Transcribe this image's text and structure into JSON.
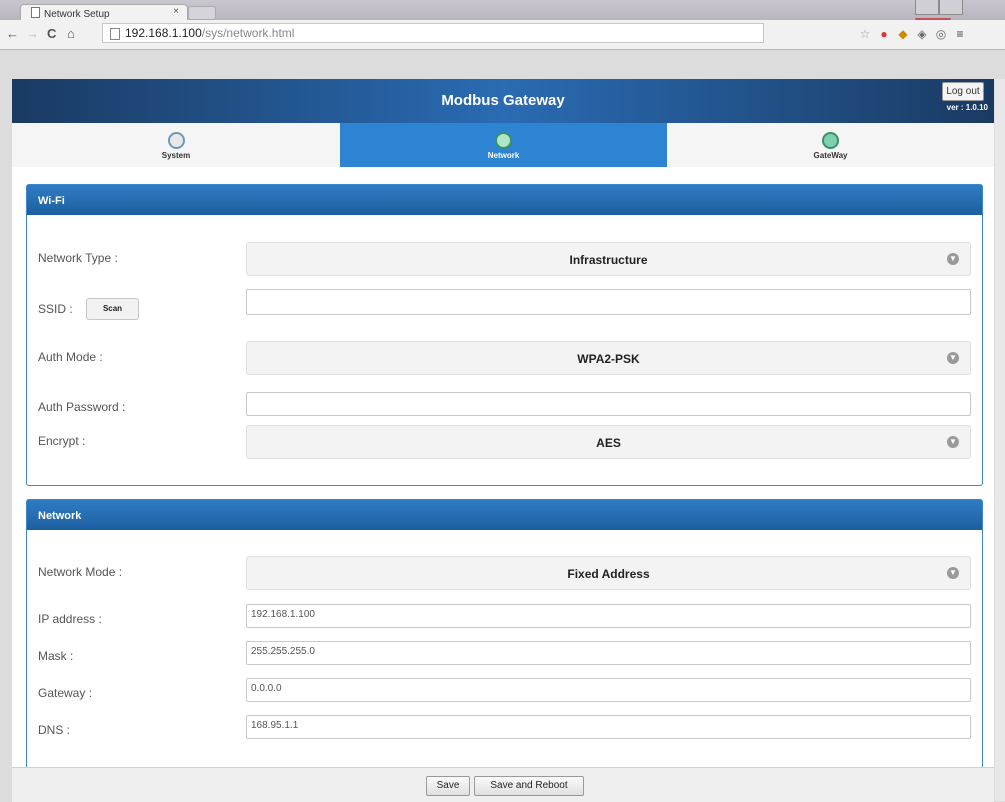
{
  "browser": {
    "tab_title": "Network Setup",
    "tab_close": "×",
    "url_host": "192.168.1.100",
    "url_path": "/sys/network.html"
  },
  "header": {
    "title": "Modbus Gateway",
    "logout_label": "Log out",
    "version": "ver : 1.0.10"
  },
  "nav": {
    "items": [
      {
        "label": "System",
        "icon": "system-icon"
      },
      {
        "label": "Network",
        "icon": "network-icon"
      },
      {
        "label": "GateWay",
        "icon": "gateway-icon"
      }
    ],
    "active": "Network"
  },
  "wifi": {
    "title": "Wi-Fi",
    "network_type_label": "Network Type :",
    "network_type_value": "Infrastructure",
    "ssid_label": "SSID :",
    "scan_label": "Scan",
    "ssid_value": "",
    "auth_mode_label": "Auth Mode :",
    "auth_mode_value": "WPA2-PSK",
    "auth_password_label": "Auth Password :",
    "auth_password_value": "",
    "encrypt_label": "Encrypt :",
    "encrypt_value": "AES"
  },
  "network": {
    "title": "Network",
    "mode_label": "Network Mode :",
    "mode_value": "Fixed Address",
    "ip_label": "IP address :",
    "ip_value": "192.168.1.100",
    "mask_label": "Mask :",
    "mask_value": "255.255.255.0",
    "gateway_label": "Gateway :",
    "gateway_value": "0.0.0.0",
    "dns_label": "DNS :",
    "dns_value": "168.95.1.1"
  },
  "footer": {
    "save_label": "Save",
    "save_reboot_label": "Save and Reboot"
  },
  "colors": {
    "header_blue": "#1a3a62",
    "active_tab": "#2c84d2",
    "panel_head": "#2f7cc3"
  }
}
